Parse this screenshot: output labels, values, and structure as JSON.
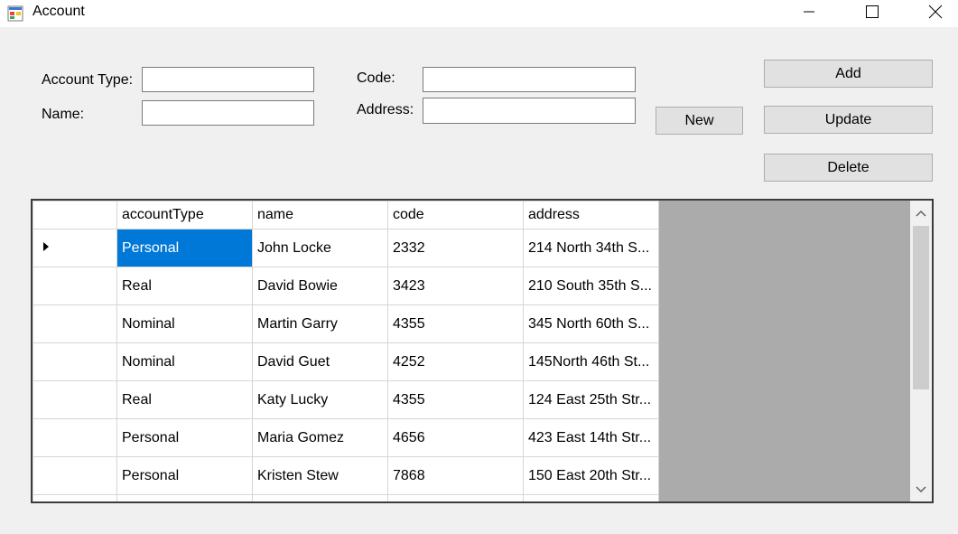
{
  "window": {
    "title": "Account",
    "minimize_icon": "minimize-icon",
    "maximize_icon": "maximize-icon",
    "close_icon": "close-icon"
  },
  "form": {
    "account_type_label": "Account Type:",
    "account_type_value": "",
    "name_label": "Name:",
    "name_value": "",
    "code_label": "Code:",
    "code_value": "",
    "address_label": "Address:",
    "address_value": ""
  },
  "buttons": {
    "new": "New",
    "add": "Add",
    "update": "Update",
    "delete": "Delete"
  },
  "grid": {
    "columns": [
      "accountType",
      "name",
      "code",
      "address"
    ],
    "rows": [
      [
        "Personal",
        "John Locke",
        "2332",
        "214 North 34th S..."
      ],
      [
        "Real",
        "David Bowie",
        "3423",
        "210 South 35th S..."
      ],
      [
        "Nominal",
        "Martin Garry",
        "4355",
        "345 North 60th S..."
      ],
      [
        "Nominal",
        "David Guet",
        "4252",
        "145North 46th St..."
      ],
      [
        "Real",
        "Katy Lucky",
        "4355",
        "124 East 25th Str..."
      ],
      [
        "Personal",
        "Maria Gomez",
        "4656",
        "423 East 14th Str..."
      ],
      [
        "Personal",
        "Kristen Stew",
        "7868",
        "150 East 20th Str..."
      ]
    ],
    "selected_row": 0,
    "current_row_icon": "current-row-arrow-icon"
  },
  "colors": {
    "selection": "#0078d7",
    "background": "#f0f0f0",
    "grid_background": "#ababab"
  }
}
